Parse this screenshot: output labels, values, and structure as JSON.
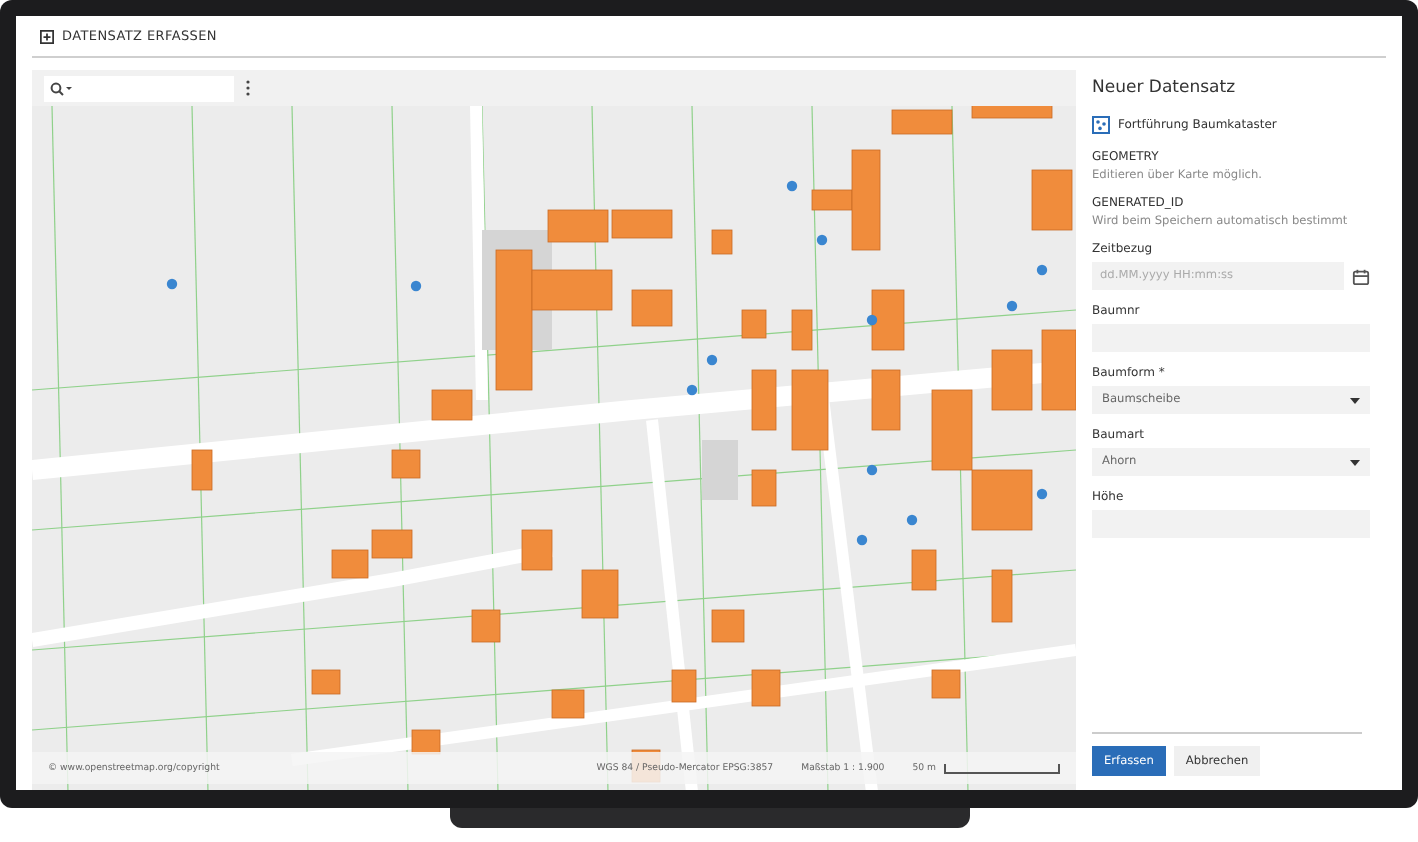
{
  "header": {
    "title": "DATENSATZ ERFASSEN"
  },
  "map": {
    "footer": {
      "copyright": "© www.openstreetmap.org/copyright",
      "projection": "WGS 84 / Pseudo-Mercator EPSG:3857",
      "scale": "Maßstab 1 : 1.900",
      "scalebar_label": "50 m"
    }
  },
  "panel": {
    "title": "Neuer Datensatz",
    "layer": "Fortführung Baumkataster",
    "fields": [
      {
        "kind": "info",
        "label": "GEOMETRY",
        "value": "Editieren über Karte möglich."
      },
      {
        "kind": "info",
        "label": "GENERATED_ID",
        "value": "Wird beim Speichern automatisch bestimmt"
      },
      {
        "kind": "date",
        "label": "Zeitbezug",
        "placeholder": "dd.MM.yyyy HH:mm:ss"
      },
      {
        "kind": "text",
        "label": "Baumnr"
      },
      {
        "kind": "select",
        "label": "Baumform *",
        "value": "Baumscheibe"
      },
      {
        "kind": "select",
        "label": "Baumart",
        "value": "Ahorn"
      },
      {
        "kind": "text",
        "label": "Höhe"
      }
    ],
    "buttons": [
      {
        "label": "Erfassen",
        "primary": true
      },
      {
        "label": "Abbrechen",
        "primary": false
      }
    ]
  }
}
